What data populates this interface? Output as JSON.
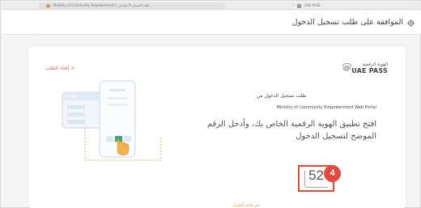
{
  "browser": {
    "tab1_label": "Ministry of Community Empowerment | طلب السجل الاجتماعي",
    "tab2_label": "UAE PASS"
  },
  "header": {
    "title": "الموافقة على طلب تسجيل الدخول"
  },
  "card": {
    "cancel_label": "إلغاء الطلب",
    "cancel_icon": "×",
    "logo_arabic": "الهوية الرقمية",
    "logo_english": "UAE PASS",
    "request_label": "طلب تسجيل الدخول من",
    "portal_name": "Ministry of Community Empowerment Web Portal",
    "instruction": "افتح تطبيق الهوية الرقمية الخاص بك، وأدخل الرقم الموضح لتسجيل الدخول",
    "verification_number": "52",
    "step_badge": "4",
    "bottom_link": "غير قابلة للتكرار"
  },
  "colors": {
    "accent_red": "#e24b3b",
    "cancel_red": "#d56a6a",
    "gold": "#c8a24e",
    "illustration_green": "#3aa876"
  }
}
